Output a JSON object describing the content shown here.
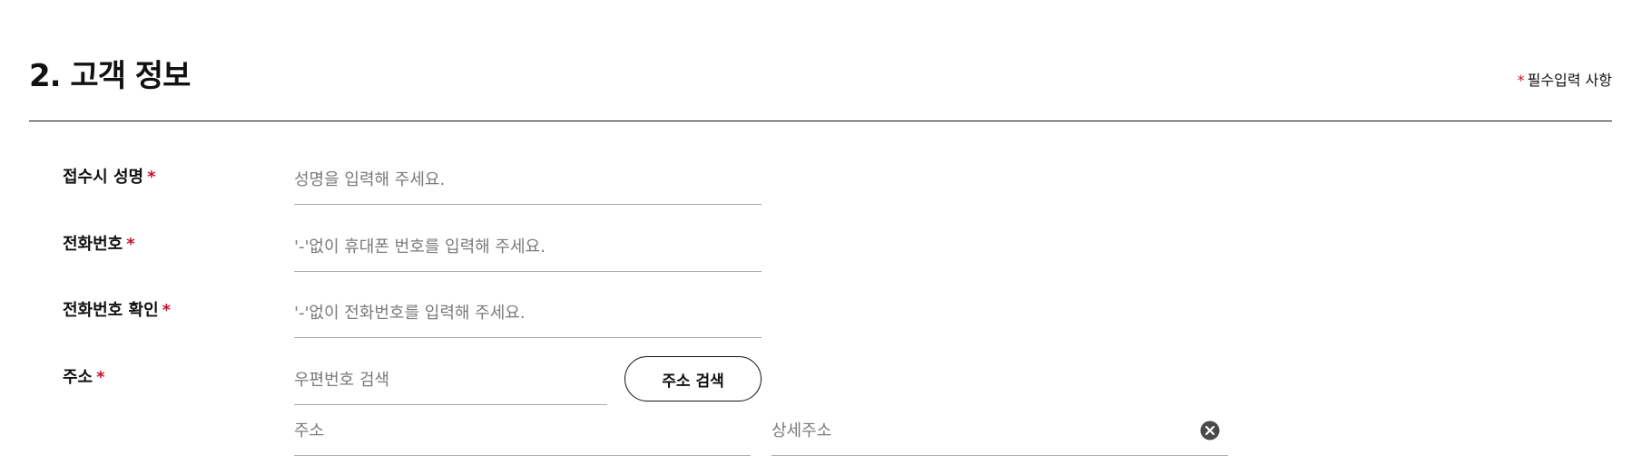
{
  "section": {
    "title": "2. 고객 정보",
    "required_note_mark": "*",
    "required_note_text": "필수입력 사항"
  },
  "fields": {
    "name": {
      "label": "접수시 성명",
      "required_mark": "*",
      "placeholder": "성명을 입력해 주세요.",
      "value": ""
    },
    "phone": {
      "label": "전화번호",
      "required_mark": "*",
      "placeholder": "'-'없이 휴대폰 번호를 입력해 주세요.",
      "value": ""
    },
    "phone_confirm": {
      "label": "전화번호 확인",
      "required_mark": "*",
      "placeholder": "'-'없이 전화번호를 입력해 주세요.",
      "value": ""
    },
    "address": {
      "label": "주소",
      "required_mark": "*",
      "postcode_placeholder": "우편번호 검색",
      "search_button_label": "주소 검색",
      "address_placeholder": "주소",
      "detail_placeholder": "상세주소"
    }
  },
  "icons": {
    "clear": "clear-circle-x"
  },
  "colors": {
    "accent_required": "#c8102e",
    "text": "#111111",
    "placeholder": "#7a7a7a",
    "underline": "#a8a8a8",
    "clear_icon": "#4a4a4a"
  }
}
